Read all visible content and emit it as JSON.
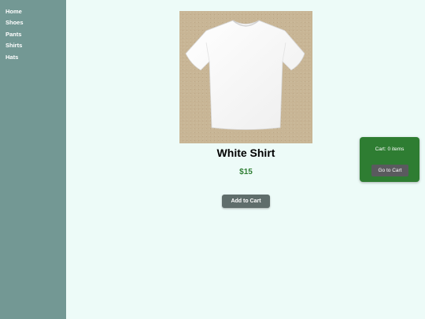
{
  "sidebar": {
    "items": [
      {
        "label": "Home"
      },
      {
        "label": "Shoes"
      },
      {
        "label": "Pants"
      },
      {
        "label": "Shirts"
      },
      {
        "label": "Hats"
      }
    ]
  },
  "product": {
    "image_icon": "white-tshirt-image",
    "title": "White Shirt",
    "price": "$15",
    "add_to_cart_label": "Add to Cart"
  },
  "cart": {
    "count_text": "Cart: 0 items",
    "go_to_cart_label": "Go to Cart"
  },
  "colors": {
    "page_background": "#edfbf8",
    "sidebar": "#739894",
    "price": "#2e7d32",
    "cart_widget": "#2e7d32",
    "add_to_cart_button": "#5f6d6b",
    "go_to_cart_button": "#5a5a5e"
  }
}
